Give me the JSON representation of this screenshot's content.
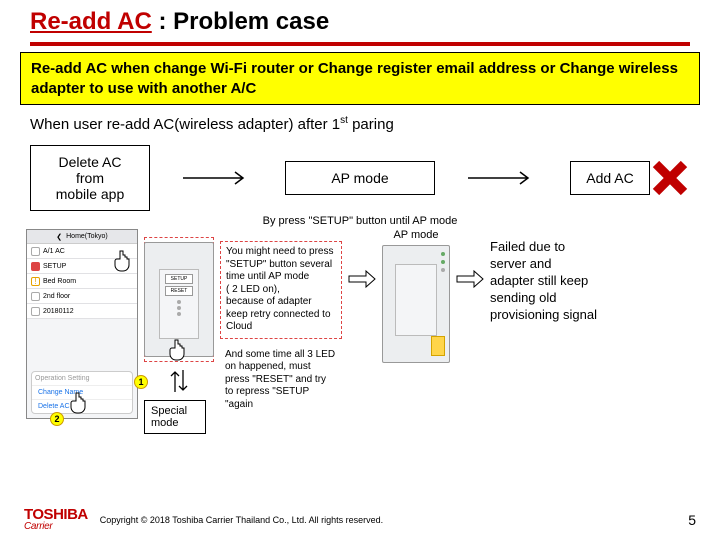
{
  "title": {
    "red": "Re-add AC",
    "rest": "  : Problem case"
  },
  "note": "Re-add AC when change Wi-Fi router or Change register email address or Change wireless adapter to use with another A/C",
  "subheading": {
    "pre": "When user re-add AC(wireless adapter) after 1",
    "sup": "st",
    "post": " paring"
  },
  "flow": {
    "box1": "Delete AC from\nmobile app",
    "box2": "AP mode",
    "box3": "Add AC"
  },
  "caption": "By press \"SETUP\" button until AP mode",
  "phone": {
    "header": "Home(Tokyo)",
    "rows": [
      "A/1 AC",
      "SETUP",
      "Bed Room",
      "2nd floor",
      "20180112"
    ],
    "popup": {
      "head": "Operation Setting",
      "opt1": "Change Name",
      "opt2": "Delete AC"
    }
  },
  "adapter": {
    "btn1": "SETUP",
    "btn2": "RESET"
  },
  "badges": {
    "b1": "1",
    "b2": "2"
  },
  "specialMode": "Special mode",
  "explain": {
    "text1": "You might need to press \"SETUP\" button several time until AP mode\n( 2 LED on),\nbecause of adapter keep retry connected to Cloud",
    "text2": "And some time all 3 LED on happened, must press \"RESET\" and try to repress \"SETUP \"again"
  },
  "apLabel": "AP mode",
  "failText": "Failed due to server and adapter still keep sending old provisioning signal",
  "footer": {
    "logo1": "TOSHIBA",
    "logo2": "Carrier",
    "copyright": "Copyright © 2018 Toshiba Carrier Thailand Co., Ltd.  All rights reserved.",
    "page": "5"
  }
}
